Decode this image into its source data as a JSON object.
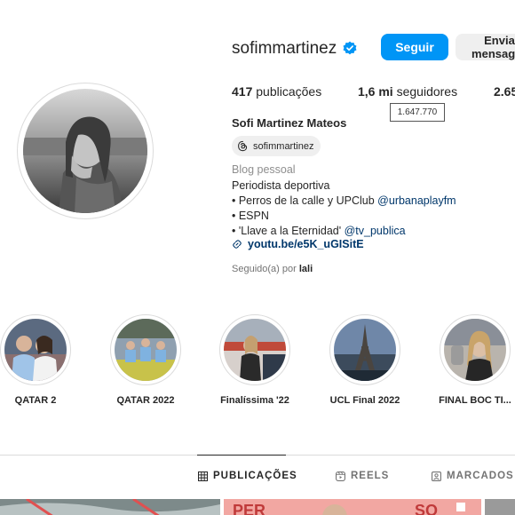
{
  "profile": {
    "username": "sofimmartinez",
    "verified": true,
    "follow_label": "Seguir",
    "message_label": "Enviar mensagem",
    "stats": {
      "posts_count": "417",
      "posts_label": "publicações",
      "followers_count": "1,6 mi",
      "followers_label": "seguidores",
      "following_partial": "2.65",
      "followers_tooltip": "1.647.770"
    },
    "full_name": "Sofi Martinez Mateos",
    "threads_handle": "sofimmartinez",
    "category": "Blog pessoal",
    "bio": {
      "line1": "Periodista deportiva",
      "line2_text": "• Perros de la calle y UPClub ",
      "line2_link": "@urbanaplayfm",
      "line3": "• ESPN",
      "line4_text": "• 'Llave a la Eternidad' ",
      "line4_link": "@tv_publica"
    },
    "bio_url": "youtu.be/e5K_uGISitE",
    "followed_by_prefix": "Seguido(a) por",
    "followed_by_user": "lali"
  },
  "highlights": [
    {
      "label": "QATAR 2"
    },
    {
      "label": "QATAR 2022"
    },
    {
      "label": "Finalíssima '22"
    },
    {
      "label": "UCL Final 2022"
    },
    {
      "label": "FINAL BOC TI..."
    }
  ],
  "tabs": [
    {
      "label": "PUBLICAÇÕES",
      "icon": "grid-icon",
      "active": true
    },
    {
      "label": "REELS",
      "icon": "reels-icon",
      "active": false
    },
    {
      "label": "MARCADOS",
      "icon": "tagged-icon",
      "active": false
    }
  ],
  "colors": {
    "accent": "#0095f6",
    "link": "#00376b",
    "muted": "#8e8e8e",
    "text": "#262626"
  }
}
